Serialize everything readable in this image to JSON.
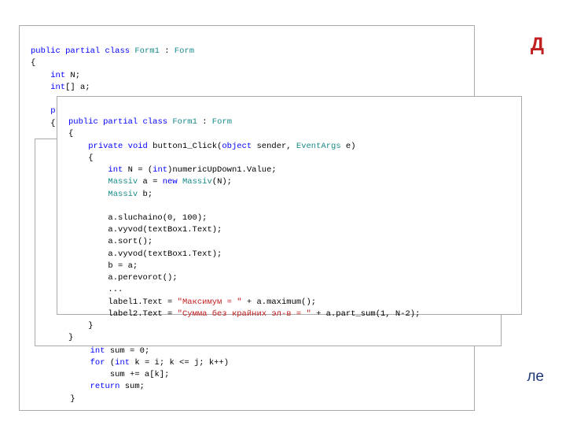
{
  "bg": {
    "red_title": "Д",
    "blue_tail": "ле"
  },
  "box1": {
    "l01a": "public",
    "l01b": "partial",
    "l01c": "class",
    "l01d": "Form1",
    "l01e": "Form",
    "l02": "{",
    "l03a": "int",
    "l03b": " N;",
    "l04a": "int",
    "l04b": "[] a;",
    "l05": "",
    "l06a": "pri",
    "l07": "{",
    "l20": "{",
    "l21a": "int",
    "l21b": " sum = 0;",
    "l22a": "for",
    "l22b": " (",
    "l22c": "int",
    "l22d": " k = i; k <= j; k++)",
    "l23": "sum += a[k];",
    "l24a": "return",
    "l24b": " sum;",
    "l25": "}"
  },
  "box3": {
    "l01a": "public",
    "l01b": "partial",
    "l01c": "class",
    "l01d": "Form1",
    "l01e": "Form",
    "l02": "{",
    "l03a": "private",
    "l03b": "void",
    "l03c": " button1_Click(",
    "l03d": "object",
    "l03e": " sender, ",
    "l03f": "EventArgs",
    "l03g": " e)",
    "l04": "{",
    "l05a": "int",
    "l05b": " N = (",
    "l05c": "int",
    "l05d": ")numericUpDown1.Value;",
    "l06a": "Massiv",
    "l06b": " a = ",
    "l06c": "new",
    "l06d": "Massiv",
    "l06e": "(N);",
    "l07a": "Massiv",
    "l07b": " b;",
    "l08": "",
    "l09": "a.sluchaino(0, 100);",
    "l10": "a.vyvod(textBox1.Text);",
    "l11": "a.sort();",
    "l12": "a.vyvod(textBox1.Text);",
    "l13": "b = a;",
    "l14": "a.perevorot();",
    "l15": "...",
    "l16a": "label1.Text = ",
    "l16b": "\"Максимум = \"",
    "l16c": " + a.maximum();",
    "l17a": "label2.Text = ",
    "l17b": "\"Сумма без крайних эл-в = \"",
    "l17c": " + a.part_sum(1, N-2);",
    "l18": "}",
    "l19": "}"
  }
}
